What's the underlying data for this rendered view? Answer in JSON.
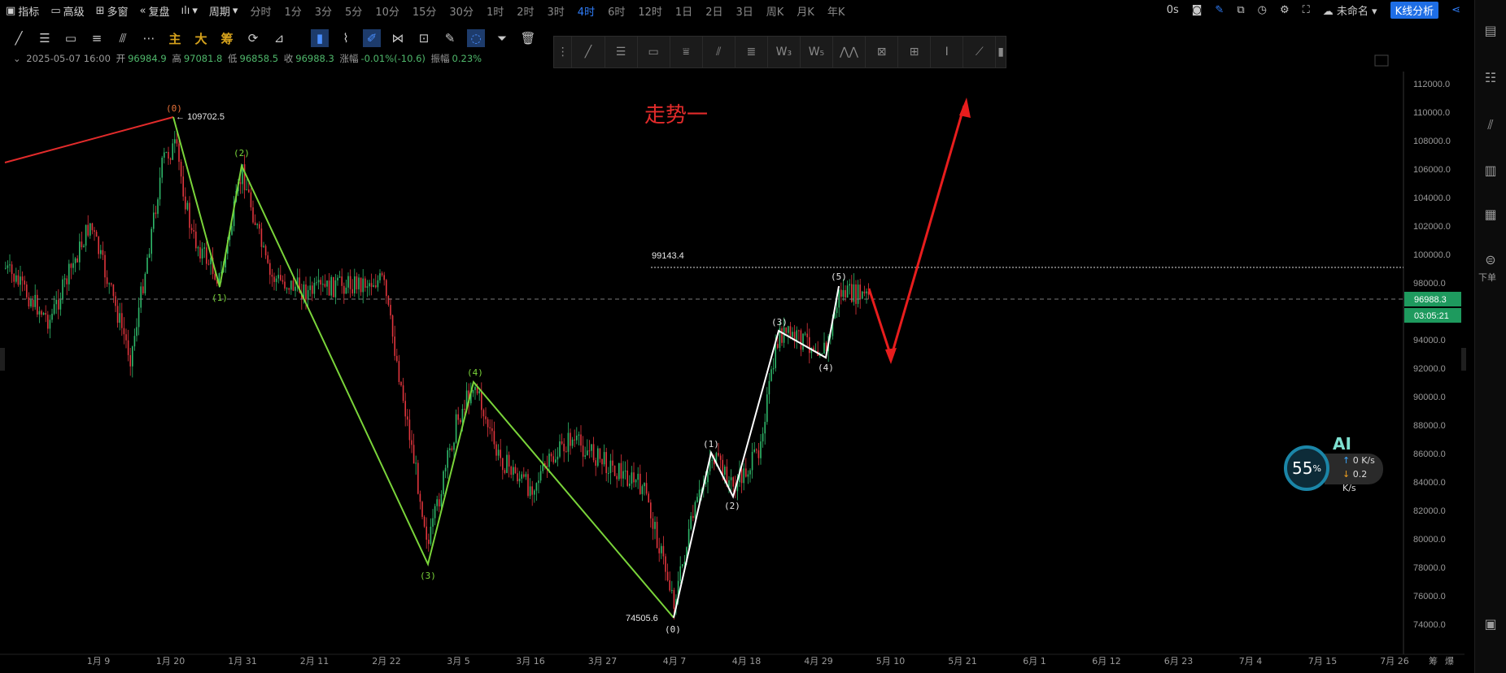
{
  "toolbar": {
    "indicator": "指标",
    "advanced": "高级",
    "multiwindow": "多窗",
    "replay": "复盘",
    "period": "周期",
    "timeframes": [
      "分时",
      "1分",
      "3分",
      "5分",
      "10分",
      "15分",
      "30分",
      "1时",
      "2时",
      "3时",
      "4时",
      "6时",
      "12时",
      "1日",
      "2日",
      "3日",
      "周K",
      "月K",
      "年K"
    ],
    "active_timeframe": "4时",
    "latency": "0s",
    "layout_name": "未命名",
    "kline_btn": "K线分析"
  },
  "drawing_tools": {
    "main": "主",
    "big": "大",
    "chips": "筹"
  },
  "info": {
    "datetime": "2025-05-07 16:00",
    "open_label": "开",
    "open": "96984.9",
    "high_label": "高",
    "high": "97081.8",
    "low_label": "低",
    "low": "96858.5",
    "close_label": "收",
    "close": "96988.3",
    "change_label": "涨幅",
    "change": "-0.01%(-10.6)",
    "amp_label": "振幅",
    "amp": "0.23%"
  },
  "annotation": {
    "title": "走势一",
    "level_line": "99143.4"
  },
  "price_axis": {
    "ticks": [
      "112000.0",
      "110000.0",
      "108000.0",
      "106000.0",
      "104000.0",
      "102000.0",
      "100000.0",
      "98000.0",
      "96000.0",
      "94000.0",
      "92000.0",
      "90000.0",
      "88000.0",
      "86000.0",
      "84000.0",
      "82000.0",
      "80000.0",
      "78000.0",
      "76000.0",
      "74000.0"
    ],
    "last_price": "96988.3",
    "countdown": "03:05:21"
  },
  "time_axis": {
    "ticks": [
      "1月 9",
      "1月 20",
      "1月 31",
      "2月 11",
      "2月 22",
      "3月 5",
      "3月 16",
      "3月 27",
      "4月 7",
      "4月 18",
      "4月 29",
      "5月 10",
      "5月 21",
      "6月 1",
      "6月 12",
      "6月 23",
      "7月 4",
      "7月 15",
      "7月 26"
    ],
    "corner": [
      "筹",
      "爆"
    ]
  },
  "wave_labels": {
    "green": [
      "(0)",
      "(1)",
      "(2)",
      "(3)",
      "(4)"
    ],
    "white": [
      "(0)",
      "(1)",
      "(2)",
      "(3)",
      "(4)",
      "(5)"
    ],
    "high_value": "109702.5",
    "low_value": "74505.6"
  },
  "right_panel": {
    "order_label": "下单"
  },
  "ai_widget": {
    "title": "AI",
    "percent": "55",
    "pct_sign": "%",
    "up": "0",
    "down": "0.2",
    "unit": "K/s"
  },
  "colors": {
    "up": "#2fb86a",
    "down": "#e0353d",
    "green_wave": "#7ad43a",
    "accent": "#2f7cf6",
    "last_price_bg": "#1e9a5e"
  }
}
